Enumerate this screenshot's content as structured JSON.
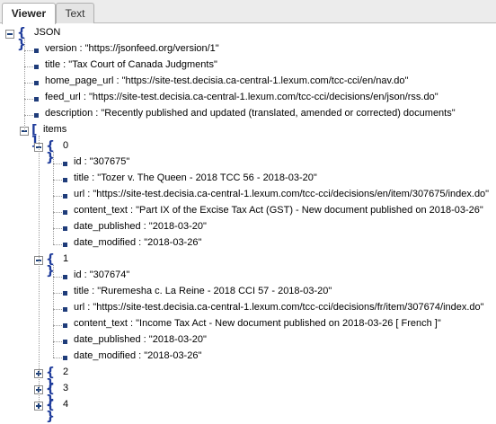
{
  "tabs": {
    "viewer": "Viewer",
    "text": "Text"
  },
  "root_label": "JSON",
  "root_props": [
    {
      "key": "version",
      "value": "\"https://jsonfeed.org/version/1\""
    },
    {
      "key": "title",
      "value": "\"Tax Court of Canada Judgments\""
    },
    {
      "key": "home_page_url",
      "value": "\"https://site-test.decisia.ca-central-1.lexum.com/tcc-cci/en/nav.do\""
    },
    {
      "key": "feed_url",
      "value": "\"https://site-test.decisia.ca-central-1.lexum.com/tcc-cci/decisions/en/json/rss.do\""
    },
    {
      "key": "description",
      "value": "\"Recently published and updated (translated, amended or corrected) documents\""
    }
  ],
  "items_label": "items",
  "items": [
    {
      "index": "0",
      "expanded": true,
      "props": [
        {
          "key": "id",
          "value": "\"307675\""
        },
        {
          "key": "title",
          "value": "\"Tozer v. The Queen - 2018 TCC 56 - 2018-03-20\""
        },
        {
          "key": "url",
          "value": "\"https://site-test.decisia.ca-central-1.lexum.com/tcc-cci/decisions/en/item/307675/index.do\""
        },
        {
          "key": "content_text",
          "value": "\"Part IX of the Excise Tax Act (GST) - New document published on 2018-03-26\""
        },
        {
          "key": "date_published",
          "value": "\"2018-03-20\""
        },
        {
          "key": "date_modified",
          "value": "\"2018-03-26\""
        }
      ]
    },
    {
      "index": "1",
      "expanded": true,
      "props": [
        {
          "key": "id",
          "value": "\"307674\""
        },
        {
          "key": "title",
          "value": "\"Ruremesha c. La Reine - 2018 CCI 57 - 2018-03-20\""
        },
        {
          "key": "url",
          "value": "\"https://site-test.decisia.ca-central-1.lexum.com/tcc-cci/decisions/fr/item/307674/index.do\""
        },
        {
          "key": "content_text",
          "value": "\"Income Tax Act - New document published on 2018-03-26 [ French ]\""
        },
        {
          "key": "date_published",
          "value": "\"2018-03-20\""
        },
        {
          "key": "date_modified",
          "value": "\"2018-03-26\""
        }
      ]
    },
    {
      "index": "2",
      "expanded": false,
      "props": []
    },
    {
      "index": "3",
      "expanded": false,
      "props": []
    },
    {
      "index": "4",
      "expanded": false,
      "props": []
    }
  ],
  "colors": {
    "icon": "#1f3c9b",
    "bullet": "#1f3c7a",
    "tabbar": "#ececec"
  }
}
